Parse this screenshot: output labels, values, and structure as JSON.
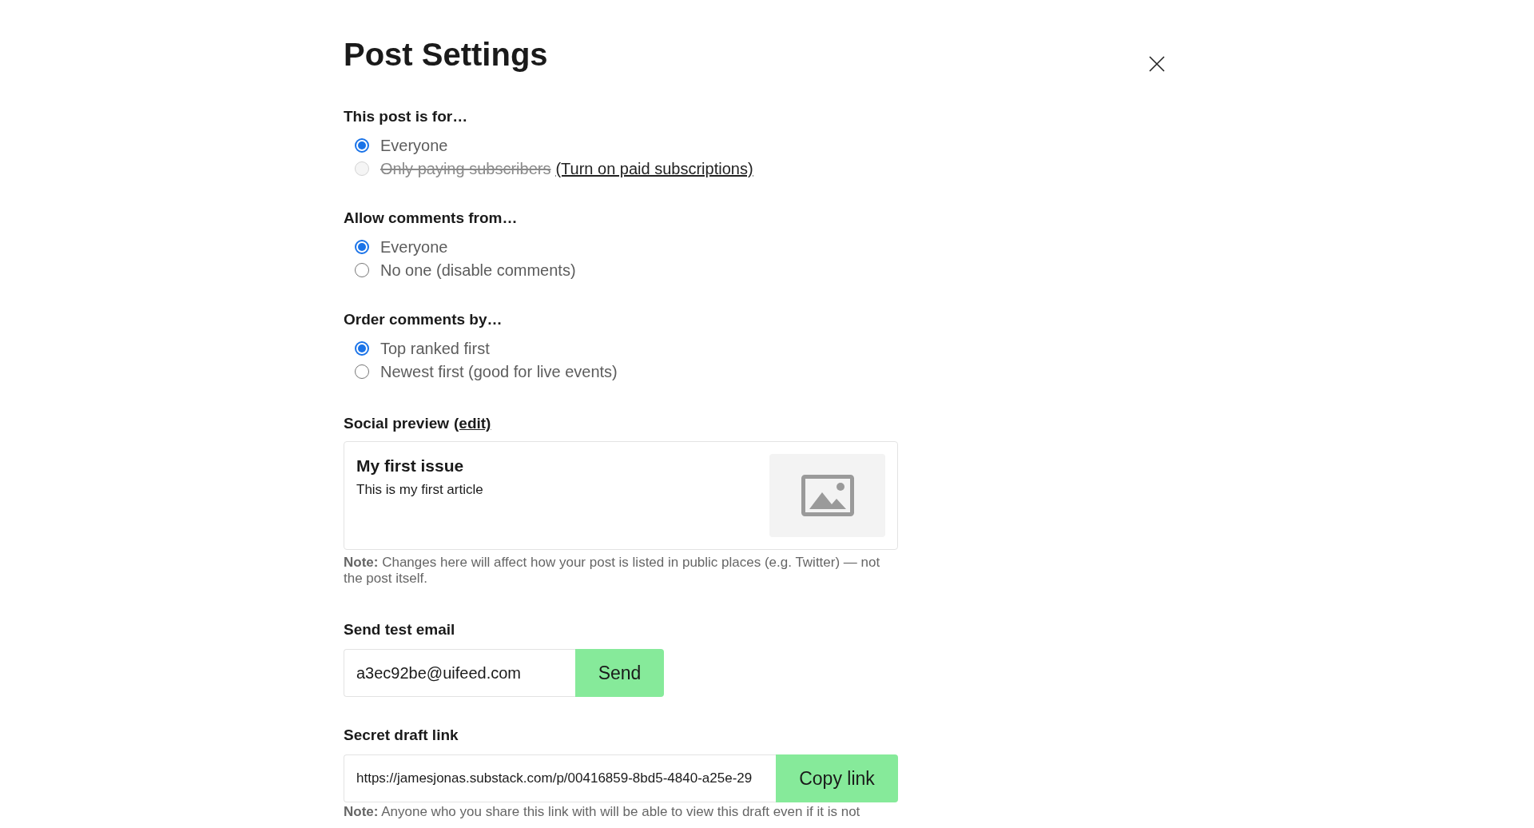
{
  "title": "Post Settings",
  "groups": [
    {
      "heading": "This post is for…",
      "options": [
        {
          "label": "Everyone",
          "selected": true,
          "disabled": false
        },
        {
          "label": "Only paying subscribers",
          "selected": false,
          "disabled": true,
          "link": "(Turn on paid subscriptions)"
        }
      ]
    },
    {
      "heading": "Allow comments from…",
      "options": [
        {
          "label": "Everyone",
          "selected": true,
          "disabled": false
        },
        {
          "label": "No one (disable comments)",
          "selected": false,
          "disabled": false
        }
      ]
    },
    {
      "heading": "Order comments by…",
      "options": [
        {
          "label": "Top ranked first",
          "selected": true,
          "disabled": false
        },
        {
          "label": "Newest first (good for live events)",
          "selected": false,
          "disabled": false
        }
      ]
    }
  ],
  "social_preview": {
    "heading": "Social preview",
    "edit_link": "(edit)",
    "card_title": "My first issue",
    "card_subtitle": "This is my first article",
    "note": "**Note:** Changes here will affect how your post is listed in public places (e.g. Twitter) — not the post itself."
  },
  "test_email": {
    "heading": "Send test email",
    "value": "a3ec92be@uifeed.com",
    "button": "Send"
  },
  "draft_link": {
    "heading": "Secret draft link",
    "value": "https://jamesjonas.substack.com/p/00416859-8bd5-4840-a25e-29",
    "button": "Copy link",
    "note": "**Note:** Anyone who you share this link with will be able to view this draft even if it is not"
  }
}
